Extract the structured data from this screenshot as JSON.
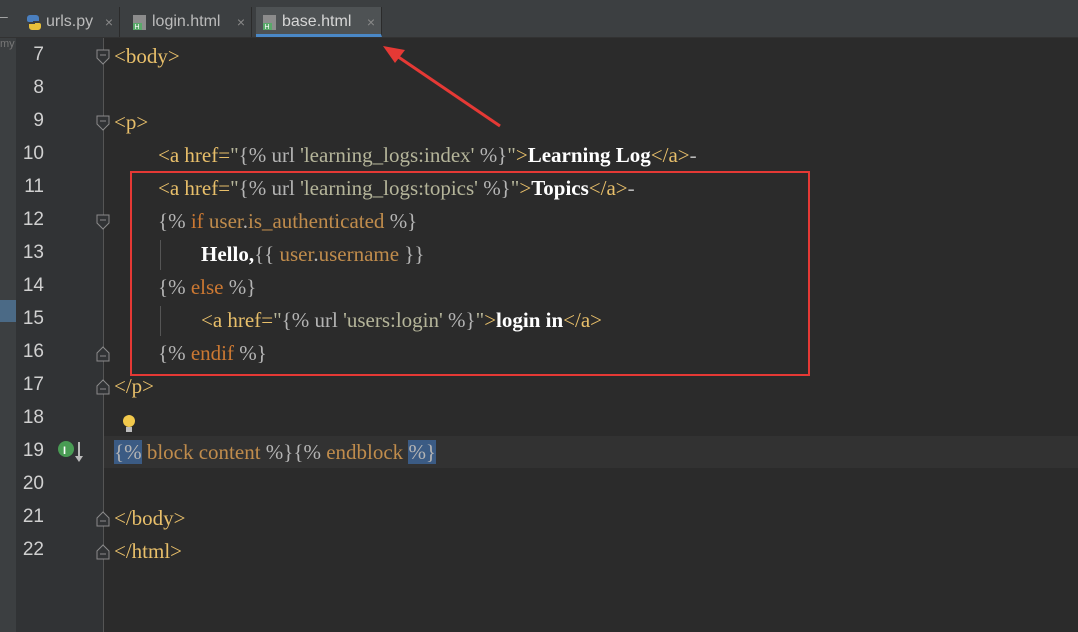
{
  "tabs": [
    {
      "name": "urls.py",
      "type": "python-file-icon",
      "active": false
    },
    {
      "name": "login.html",
      "type": "html-file-icon",
      "active": false
    },
    {
      "name": "base.html",
      "type": "html-file-icon",
      "active": true
    }
  ],
  "tab_close": "×",
  "side_mark": "my",
  "menu_glyph": "–",
  "editor": {
    "lines": [
      {
        "num": "7"
      },
      {
        "num": "8"
      },
      {
        "num": "9"
      },
      {
        "num": "10"
      },
      {
        "num": "11"
      },
      {
        "num": "12"
      },
      {
        "num": "13"
      },
      {
        "num": "14"
      },
      {
        "num": "15"
      },
      {
        "num": "16"
      },
      {
        "num": "17"
      },
      {
        "num": "18"
      },
      {
        "num": "19"
      },
      {
        "num": "20"
      },
      {
        "num": "21"
      },
      {
        "num": "22"
      }
    ],
    "code": {
      "l7": "<body>",
      "l9": "<p>",
      "l10": {
        "open": "<a href=",
        "q1": "\"",
        "tpl": "{% url ",
        "str": "'learning_logs:index'",
        "tpl_end": " %}",
        "q2": "\"",
        "gt": ">",
        "text": "Learning Log",
        "close": "</a>",
        "tail": "-"
      },
      "l11": {
        "open": "<a href=",
        "q1": "\"",
        "tpl": "{% url ",
        "str": "'learning_logs:topics'",
        "tpl_end": " %}",
        "q2": "\"",
        "gt": ">",
        "text": "Topics",
        "close": "</a>",
        "tail": "-"
      },
      "l12": {
        "open": "{% ",
        "kw": "if ",
        "var1": "user",
        "dot": ".",
        "var2": "is_authenticated",
        "close": " %}"
      },
      "l13": {
        "text": "Hello,",
        "open": "{{ ",
        "var1": "user",
        "dot": ".",
        "var2": "username",
        "close": " }}"
      },
      "l14": {
        "open": "{% ",
        "kw": "else",
        "close": " %}"
      },
      "l15": {
        "open": "<a href=",
        "q1": "\"",
        "tpl": "{% url ",
        "str": "'users:login'",
        "tpl_end": " %}",
        "q2": "\"",
        "gt": ">",
        "text": "login in",
        "close": "</a>"
      },
      "l16": {
        "open": "{% ",
        "kw": "endif",
        "close": " %}"
      },
      "l17": "</p>",
      "l19": {
        "b1": "{%",
        "a": " block content ",
        "b2": "%}",
        "b3": "{%",
        "c": " endblock ",
        "b4": "%}"
      },
      "l21": "</body>",
      "l22": "</html>"
    }
  },
  "colors": {
    "annotation": "#e53935",
    "active_tab_underline": "#4a88c7"
  }
}
